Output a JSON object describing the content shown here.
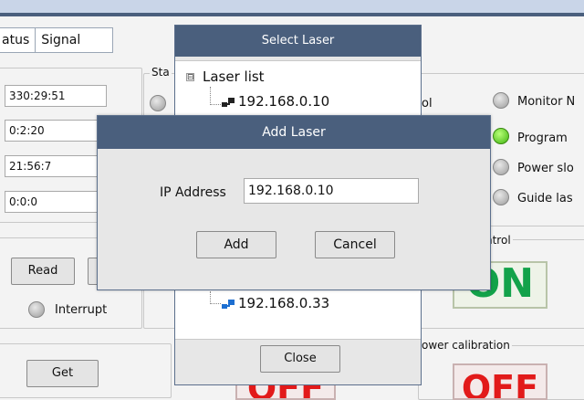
{
  "tabs": [
    "atus",
    "Signal"
  ],
  "left_fields": [
    "330:29:51",
    "0:2:20",
    "21:56:7",
    "0:0:0"
  ],
  "left_buttons": {
    "read": "Read",
    "get": "Get"
  },
  "interrupt_label": "Interrupt",
  "status_group_label": "Sta",
  "right_panel": {
    "control_partial": "ol",
    "indicators": [
      "Monitor N",
      "Program",
      "Power slo",
      "Guide las"
    ],
    "control_label": "ntrol",
    "on_text": "ON",
    "power_calibration_label": "ower  calibration",
    "off_text": "OFF"
  },
  "select_laser": {
    "title": "Select Laser",
    "tree_root": "Laser list",
    "expander_symbol": "⊟",
    "items": [
      "192.168.0.10",
      "192.168.0.33"
    ],
    "close_label": "Close"
  },
  "add_laser": {
    "title": "Add Laser",
    "ip_label": "IP Address",
    "ip_value": "192.168.0.10",
    "add_label": "Add",
    "cancel_label": "Cancel"
  },
  "colors": {
    "title_bar": "#4a5f7d",
    "on_green": "#13a24a",
    "off_red": "#e21a1a",
    "led_green": "#3fb30f"
  }
}
